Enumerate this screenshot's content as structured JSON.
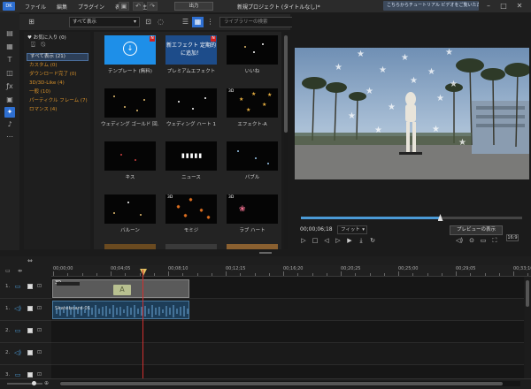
{
  "titlebar": {
    "logo": "DK",
    "menu": [
      "ファイル",
      "編集",
      "プラグイン",
      "表示",
      "再生"
    ],
    "output_label": "出力",
    "title": "新規プロジェクト (タイトルなし)*",
    "tutorial": "こちらからチュートリアル ビデオをご覧いただけます。"
  },
  "library": {
    "view_select": "すべて表示",
    "search_placeholder": "ライブラリーの検索"
  },
  "categories": {
    "header": "お気に入り (0)",
    "items": [
      {
        "label": "すべて表示 (21)",
        "selected": true
      },
      {
        "label": "カスタム (0)"
      },
      {
        "label": "ダウンロード完了 (0)"
      },
      {
        "label": "3D/3D-Like (4)"
      },
      {
        "label": "一般 (10)"
      },
      {
        "label": "パーティクル フレーム (7)"
      },
      {
        "label": "ロマンス (4)"
      }
    ]
  },
  "thumbnails": [
    {
      "label": "テンプレート (無料)",
      "kind": "download",
      "badge": "N"
    },
    {
      "label": "プレミアムエフェクト",
      "kind": "premium",
      "badge": "N",
      "text": "新エフェクト 定期的に追加！"
    },
    {
      "label": "いいね",
      "kind": "dark"
    },
    {
      "label": "ウェディング ゴールド 回...",
      "kind": "dark"
    },
    {
      "label": "ウェディング ハート 1",
      "kind": "dark"
    },
    {
      "label": "エフェクト-A",
      "kind": "stars",
      "tag": "3D"
    },
    {
      "label": "キス",
      "kind": "dark"
    },
    {
      "label": "ニュース",
      "kind": "dark"
    },
    {
      "label": "バブル",
      "kind": "dark"
    },
    {
      "label": "バルーン",
      "kind": "dark"
    },
    {
      "label": "モミジ",
      "kind": "leaves",
      "tag": "3D"
    },
    {
      "label": "ラブ ハート",
      "kind": "hearts",
      "tag": "3D"
    }
  ],
  "preview": {
    "timecode": "00;00;06;18",
    "fit_label": "フィット",
    "preview_button": "プレビューの表示",
    "progress": 0.63,
    "res_badge": "16:9"
  },
  "timeline": {
    "ruler_ticks": [
      "00;00;00",
      "00;04;05",
      "00;08;10",
      "00;12;15",
      "00;16;20",
      "00;20;25",
      "00;25;00",
      "00;29;05",
      "00;33;10"
    ],
    "tracks": [
      {
        "num": "1.",
        "type": "video"
      },
      {
        "num": "1.",
        "type": "audio"
      },
      {
        "num": "2.",
        "type": "video"
      },
      {
        "num": "2.",
        "type": "audio"
      },
      {
        "num": "3.",
        "type": "video"
      }
    ],
    "video_clip": {
      "tag": "3D",
      "title_icon": "A"
    },
    "audio_clip": {
      "name": "Skateboard-01"
    }
  },
  "colors": {
    "accent": "#2e6fd1",
    "playhead": "#d03030",
    "category_text": "#d6902a"
  }
}
